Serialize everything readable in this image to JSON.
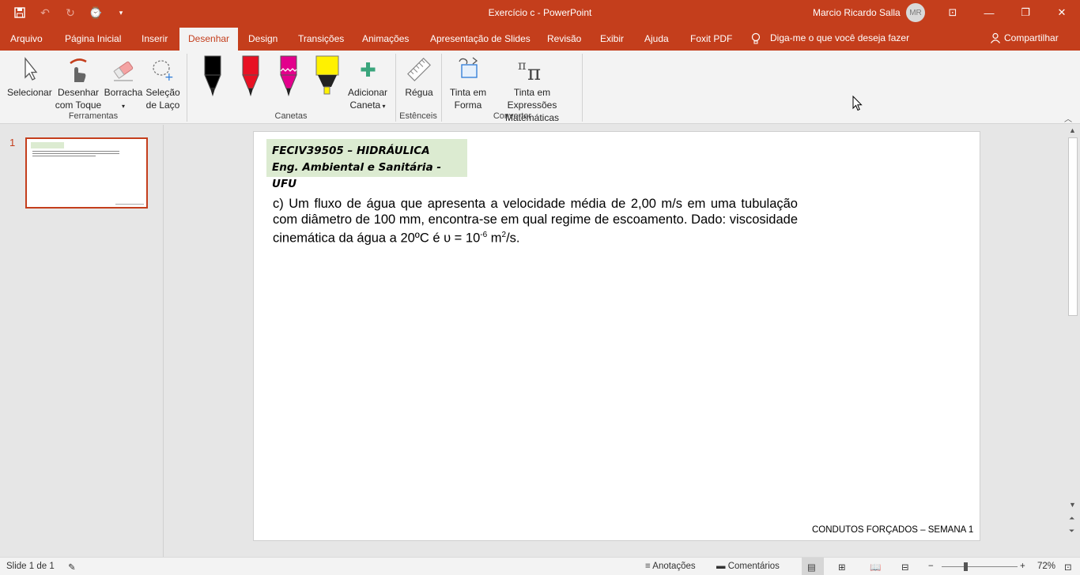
{
  "window": {
    "title": "Exercício c  -  PowerPoint",
    "user": "Marcio Ricardo Salla",
    "avatar_initials": "MR"
  },
  "tabs": [
    {
      "label": "Arquivo"
    },
    {
      "label": "Página Inicial"
    },
    {
      "label": "Inserir"
    },
    {
      "label": "Desenhar",
      "active": true
    },
    {
      "label": "Design"
    },
    {
      "label": "Transições"
    },
    {
      "label": "Animações"
    },
    {
      "label": "Apresentação de Slides"
    },
    {
      "label": "Revisão"
    },
    {
      "label": "Exibir"
    },
    {
      "label": "Ajuda"
    },
    {
      "label": "Foxit PDF"
    }
  ],
  "tellme": "Diga-me o que você deseja fazer",
  "share": "Compartilhar",
  "ribbon": {
    "tools": {
      "selecionar": "Selecionar",
      "desenhar_1": "Desenhar",
      "desenhar_2": "com Toque",
      "borracha": "Borracha",
      "selecao_1": "Seleção",
      "selecao_2": "de Laço",
      "group": "Ferramentas"
    },
    "pens": {
      "adicionar_1": "Adicionar",
      "adicionar_2": "Caneta",
      "group": "Canetas",
      "colors": [
        "#000000",
        "#e81123",
        "#e3008c",
        "#fff100"
      ]
    },
    "stencils": {
      "regua": "Régua",
      "group": "Estênceis"
    },
    "convert": {
      "tinta_forma_1": "Tinta em",
      "tinta_forma_2": "Forma",
      "tinta_expr_1": "Tinta em Expressões",
      "tinta_expr_2": "Matemáticas",
      "group": "Converter"
    }
  },
  "thumbnail": {
    "number": "1"
  },
  "slide": {
    "header_line1": "FECIV39505 – HIDRÁULICA",
    "header_line2": "Eng. Ambiental e Sanitária - UFU",
    "body_part1": "c)  Um fluxo de água que apresenta a velocidade média de 2,00 m/s em uma tubulação com diâmetro de 100 mm, encontra-se em qual regime de escoamento. Dado:  viscosidade cinemática da água a 20ºC é υ = 10",
    "body_exp": "-6",
    "body_part2": " m",
    "body_sq": "2",
    "body_part3": "/s.",
    "footer": "CONDUTOS FORÇADOS – SEMANA 1"
  },
  "status": {
    "slide": "Slide 1 de 1",
    "notes": "Anotações",
    "comments": "Comentários",
    "zoom": "72%",
    "zoom_level_percent": 72
  }
}
